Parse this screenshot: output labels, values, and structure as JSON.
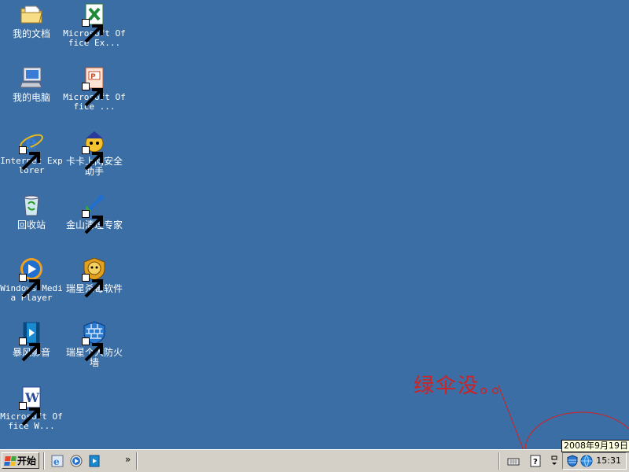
{
  "desktop": {
    "icons": [
      {
        "label": "我的文档",
        "icon": "my-documents-icon"
      },
      {
        "label": "Microsoft Office Ex...",
        "icon": "excel-icon"
      },
      {
        "label": "我的电脑",
        "icon": "my-computer-icon"
      },
      {
        "label": "Microsoft Office ...",
        "icon": "powerpoint-icon"
      },
      {
        "label": "Internet Explorer",
        "icon": "internet-explorer-icon"
      },
      {
        "label": "卡卡上网安全助手",
        "icon": "kaka-security-icon"
      },
      {
        "label": "回收站",
        "icon": "recycle-bin-icon"
      },
      {
        "label": "金山清理专家",
        "icon": "kingsoft-cleaner-icon"
      },
      {
        "label": "Windows Media Player",
        "icon": "media-player-icon"
      },
      {
        "label": "瑞星杀毒软件",
        "icon": "rising-antivirus-icon"
      },
      {
        "label": "暴风影音",
        "icon": "storm-player-icon"
      },
      {
        "label": "瑞星个人防火墙",
        "icon": "rising-firewall-icon"
      },
      {
        "label": "Microsoft Office W...",
        "icon": "word-icon"
      }
    ]
  },
  "annotation": {
    "text": "绿伞没。。",
    "color": "#d32020"
  },
  "taskbar": {
    "start_label": "开始",
    "chevron": "»",
    "clock": "15:31",
    "date_tooltip": "2008年9月19日"
  },
  "colors": {
    "desktop": "#3a6ea5",
    "taskbar": "#d4d0c8"
  }
}
